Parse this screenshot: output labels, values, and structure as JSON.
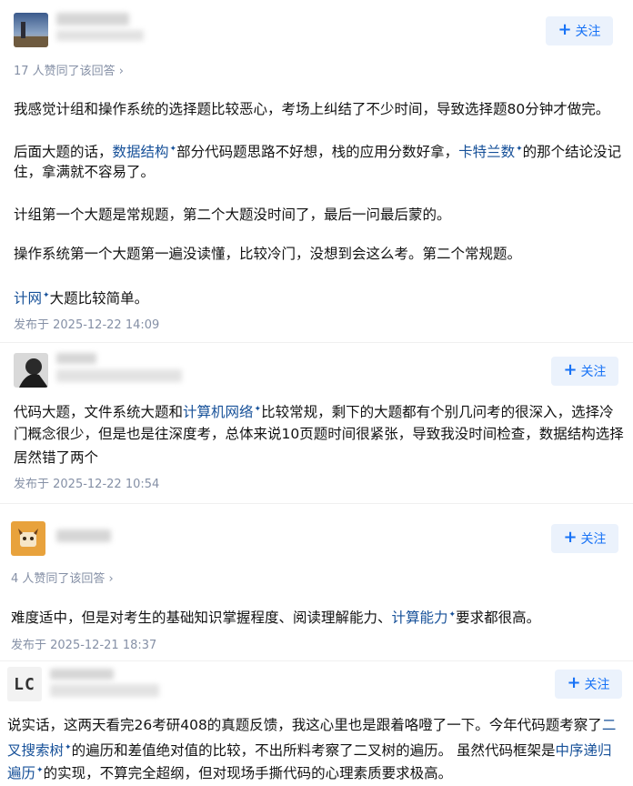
{
  "follow_label": "关注",
  "answers": [
    {
      "votes": "17 人赞同了该回答 ›",
      "p1": "我感觉计组和操作系统的选择题比较恶心，考场上纠结了不少时间，导致选择题80分钟才做完。",
      "p2a": "后面大题的话，",
      "p2link1": "数据结构",
      "p2b": "部分代码题思路不好想，栈的应用分数好拿，",
      "p2link2": "卡特兰数",
      "p2c": "的那个结论没记",
      "p2d": "住，拿满就不容易了。",
      "p3": "计组第一个大题是常规题，第二个大题没时间了，最后一问最后蒙的。",
      "p4": "操作系统第一个大题第一遍没读懂，比较冷门，没想到会这么考。第二个常规题。",
      "p5link": "计网",
      "p5": "大题比较简单。",
      "date": "发布于 2025-12-22 14:09"
    },
    {
      "l1a": "代码大题，文件系统大题和",
      "l1link": "计算机网络",
      "l1b": "比较常规，剩下的大题都有个别几问考的很深入，选择冷",
      "l2": "门概念很少，但是也是往深度考，总体来说10页题时间很紧张，导致我没时间检查，数据结构选择",
      "l3": "居然错了两个",
      "date": "发布于 2025-12-22 10:54"
    },
    {
      "votes": "4 人赞同了该回答 ›",
      "pa": "难度适中，但是对考生的基础知识掌握程度、阅读理解能力、",
      "plink": "计算能力",
      "pb": "要求都很高。",
      "date": "发布于 2025-12-21 18:37"
    },
    {
      "avatar_text": "LC",
      "l1a": "说实话，这两天看完26考研408的真题反馈，我这心里也是跟着咯噔了一下。今年代码题考察了",
      "l1link": "二",
      "l2link": "叉搜索树",
      "l2a": "的遍历和差值绝对值的比较，不出所料考察了二叉树的遍历。 虽然代码框架是",
      "l2link2": "中序递归",
      "l3link": "遍历",
      "l3a": "的实现，不算完全超纲，但对现场手撕代码的心理素质要求极高。"
    }
  ],
  "colors": {
    "link": "#175199",
    "follow_bg": "#ebf2fc",
    "follow_text": "#1772f6",
    "meta": "#8590a6"
  }
}
